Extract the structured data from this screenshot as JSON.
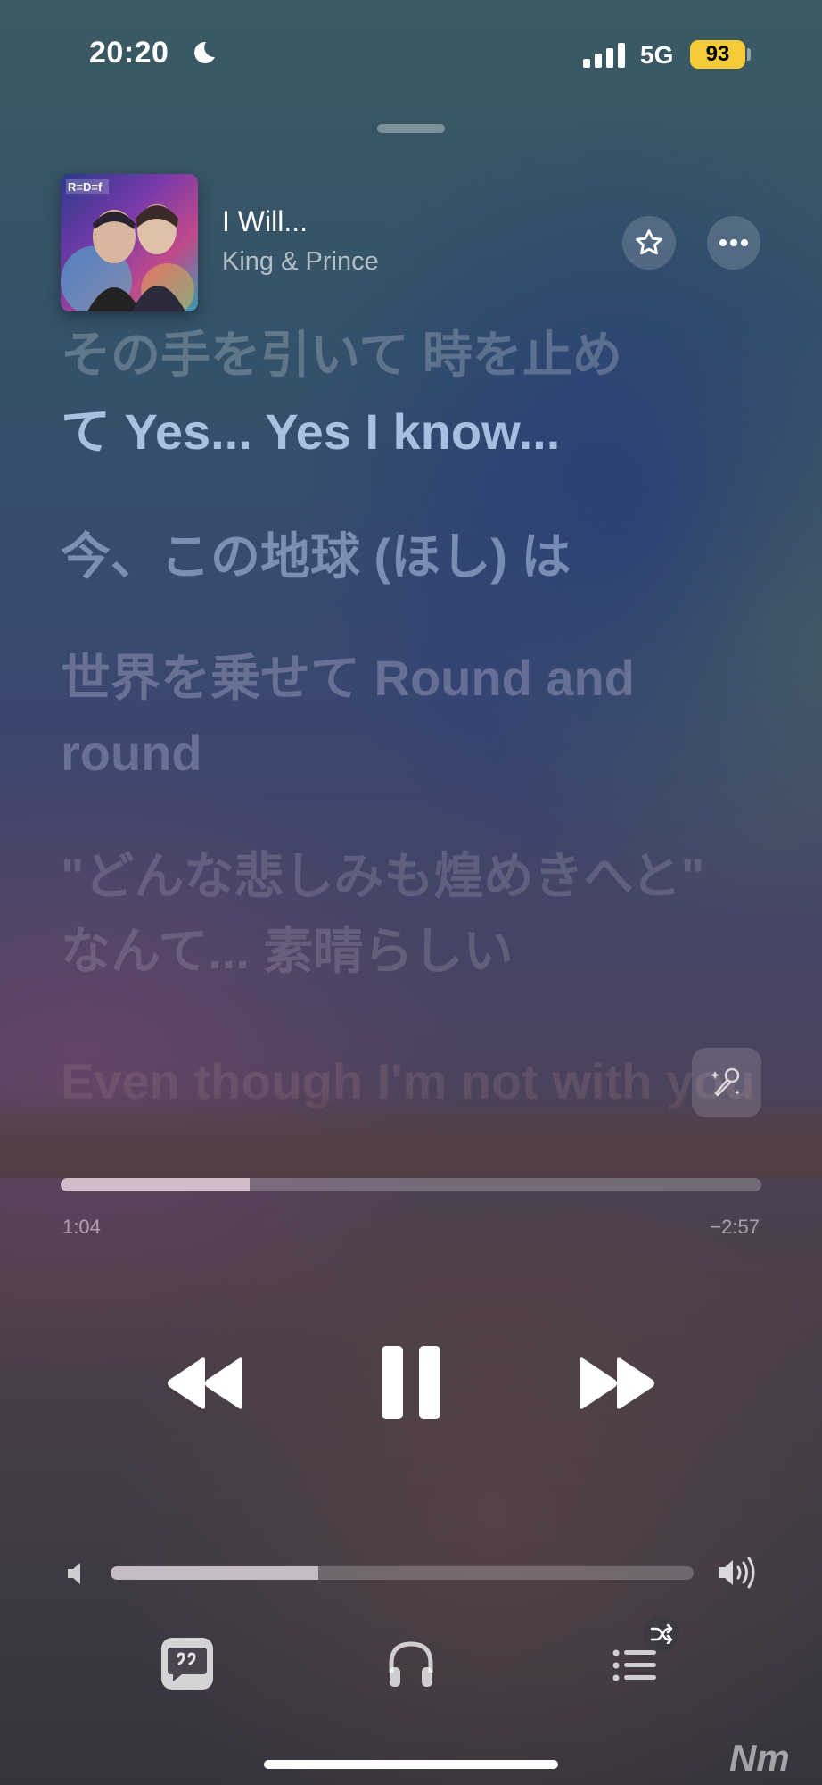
{
  "status_bar": {
    "time": "20:20",
    "network": "5G",
    "battery": "93",
    "battery_color": "#f5cc38"
  },
  "now_playing": {
    "artwork_label": "R≡D≡f",
    "title": "I Will...",
    "artist": "King & Prince"
  },
  "lyrics": [
    "その手を引いて 時を止め",
    "て Yes... Yes I know...",
    "今、この地球 (ほし) は",
    "世界を乗せて Round and round",
    "\"どんな悲しみも煌めきへと\" なんて... 素晴らしい",
    "Even though I'm not with you"
  ],
  "playback": {
    "elapsed": "1:04",
    "remaining": "−2:57",
    "progress_fraction": 0.27
  },
  "volume": {
    "level_fraction": 0.356
  },
  "icons": {
    "favorite": "star-icon",
    "more": "ellipsis-icon",
    "sing": "microphone-sparkle-icon",
    "previous": "rewind-icon",
    "pause": "pause-icon",
    "next": "fast-forward-icon",
    "lyrics": "quote-bubble-icon",
    "output": "headphones-icon",
    "queue": "list-icon",
    "shuffle": "shuffle-icon"
  },
  "watermark": "Nm"
}
